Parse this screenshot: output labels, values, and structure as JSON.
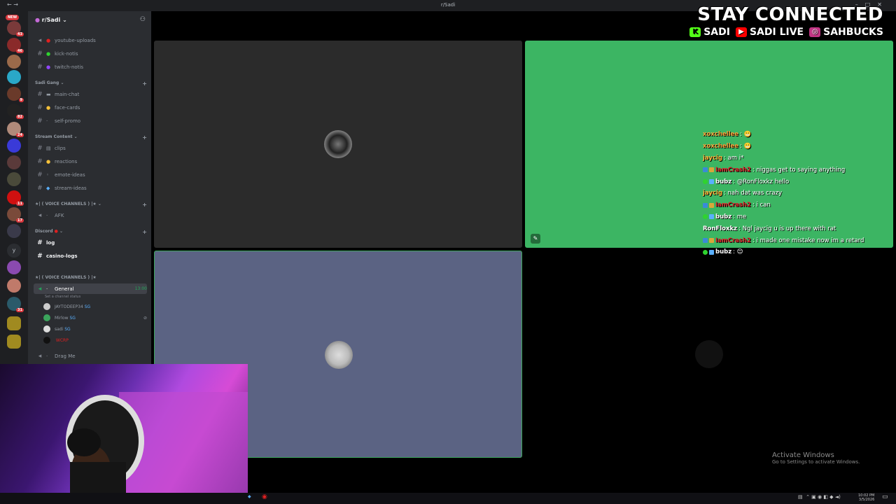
{
  "window": {
    "title": "r/Sadi"
  },
  "server_rail": {
    "new_label": "NEW",
    "badges": [
      "43",
      "46",
      "9",
      "82",
      "24",
      "11",
      "17",
      "31"
    ],
    "letter": "y"
  },
  "sidebar": {
    "server_name": "r/Sadi",
    "channels_top": [
      {
        "label": "youtube-uploads"
      },
      {
        "label": "kick-notis"
      },
      {
        "label": "twitch-notis"
      }
    ],
    "cat_sadi_gang": "Sadi Gang",
    "sadi_gang_channels": [
      {
        "label": "main-chat"
      },
      {
        "label": "face-cards"
      },
      {
        "label": "self-promo"
      }
    ],
    "cat_stream_content": "Stream Content",
    "stream_channels": [
      {
        "label": "clips"
      },
      {
        "label": "reactions"
      },
      {
        "label": "emote-ideas"
      },
      {
        "label": "stream-ideas"
      }
    ],
    "cat_voice_1": "★| ( VOICE CHANNELS ) |★",
    "afk": "AFK",
    "cat_discord": "Discord",
    "log": "log",
    "casino_logs": "casino-logs",
    "cat_voice_2": "★| ( VOICE CHANNELS ) |★",
    "general": "General",
    "general_time": "13:00",
    "general_status": "Set a channel status",
    "voice_users": [
      {
        "name": "JAYTODEEP34",
        "tag": "SG"
      },
      {
        "name": "Mirlow",
        "tag": "SG"
      },
      {
        "name": "sadi",
        "tag": "SG"
      },
      {
        "name": "",
        "tag": "WCRP"
      }
    ],
    "drag_me": "Drag Me"
  },
  "overlay": {
    "stay_connected": "STAY CONNECTED",
    "kick": "SADI",
    "youtube": "SADI LIVE",
    "instagram": "SAHBUCKS"
  },
  "chat": [
    {
      "name": "xoxchellee",
      "msg": ": 😬",
      "color": "#f7a23a"
    },
    {
      "name": "xoxchellee",
      "msg": ": 😬",
      "color": "#f7a23a"
    },
    {
      "name": "jaycig",
      "msg": ": am i*",
      "color": "#ffb43a"
    },
    {
      "name": "IamCrash2",
      "msg": ": niggas get to saying anything",
      "color": "#e0242c"
    },
    {
      "name": "bubz",
      "msg": ": @RonFloxkz hello",
      "color": "#ffffff"
    },
    {
      "name": "jaycig",
      "msg": ": nah dat was crazy",
      "color": "#ffb43a"
    },
    {
      "name": "IamCrash2",
      "msg": ": i can",
      "color": "#e0242c"
    },
    {
      "name": "bubz",
      "msg": ": me",
      "color": "#ffffff"
    },
    {
      "name": "RonFloxkz",
      "msg": ": Ngl jaycig u is up there with rat",
      "color": "#ffffff"
    },
    {
      "name": "IamCrash2",
      "msg": ": i made one mistake now im a retard",
      "color": "#e0242c"
    },
    {
      "name": "bubz",
      "msg": ": 😊",
      "color": "#ffffff"
    }
  ],
  "watermark": {
    "line1": "Activate Windows",
    "line2": "Go to Settings to activate Windows."
  },
  "taskbar": {
    "time": "10:02 PM",
    "date": "3/5/2026"
  },
  "colors": {
    "green_tile": "#3cb563",
    "grey_tile": "#2b2b2b",
    "blue_tile": "#5b6383",
    "speaking": "#3ba55c"
  }
}
